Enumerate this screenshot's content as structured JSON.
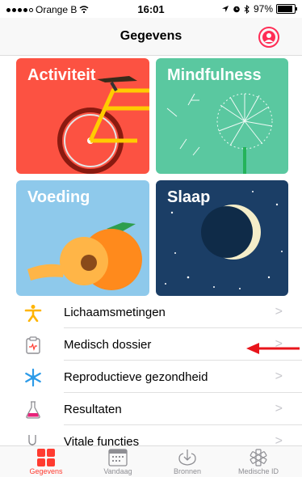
{
  "status_bar": {
    "carrier": "Orange B",
    "time": "16:01",
    "battery": "97%"
  },
  "nav": {
    "title": "Gegevens"
  },
  "tiles": [
    {
      "label": "Activiteit"
    },
    {
      "label": "Mindfulness"
    },
    {
      "label": "Voeding"
    },
    {
      "label": "Slaap"
    }
  ],
  "list": [
    {
      "label": "Lichaamsmetingen",
      "icon": "person-icon",
      "chevron": ">"
    },
    {
      "label": "Medisch dossier",
      "icon": "clipboard-icon",
      "chevron": ">"
    },
    {
      "label": "Reproductieve gezondheid",
      "icon": "snowflake-icon",
      "chevron": ">"
    },
    {
      "label": "Resultaten",
      "icon": "flask-icon",
      "chevron": ">"
    },
    {
      "label": "Vitale functies",
      "icon": "stethoscope-icon",
      "chevron": ">"
    }
  ],
  "tabs": [
    {
      "label": "Gegevens",
      "active": true
    },
    {
      "label": "Vandaag"
    },
    {
      "label": "Bronnen"
    },
    {
      "label": "Medische ID"
    }
  ],
  "colors": {
    "accent": "#ff3b30",
    "activity": "#fc5242",
    "mindfulness": "#5ac8a0",
    "nutrition": "#8ec9eb",
    "sleep": "#1b3e66"
  }
}
